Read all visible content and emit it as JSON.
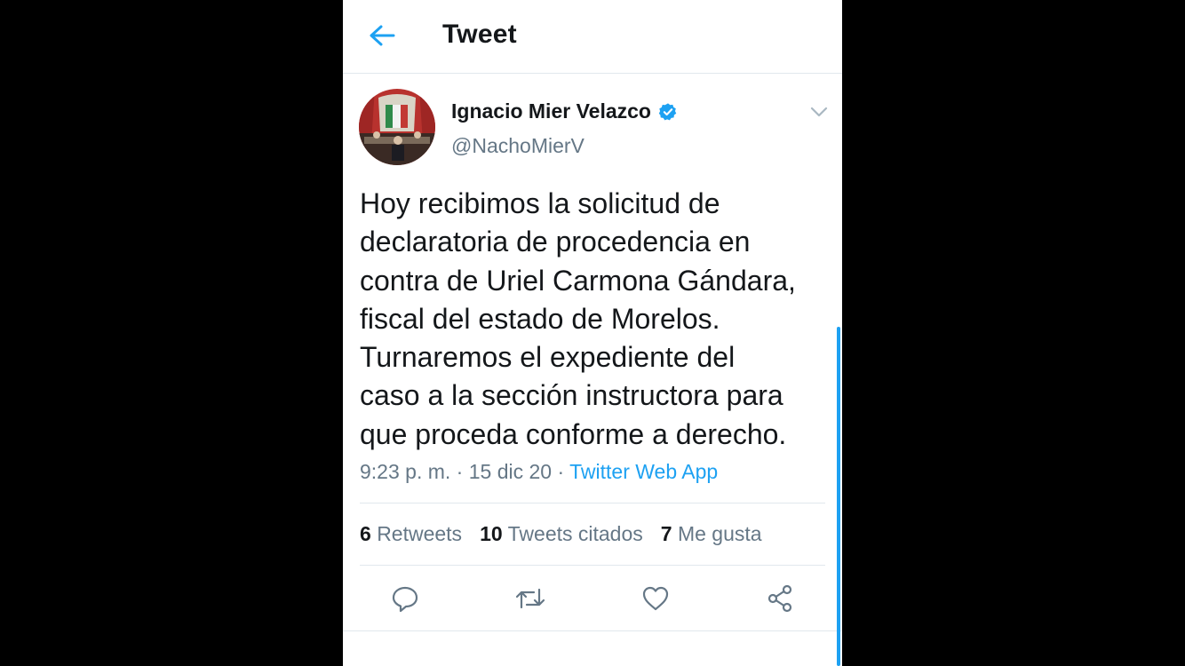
{
  "header": {
    "title": "Tweet",
    "back_icon": "arrow-left-icon"
  },
  "tweet": {
    "author": {
      "name": "Ignacio Mier Velazco",
      "handle": "@NachoMierV",
      "verified": true
    },
    "text": "Hoy recibimos la solicitud de\ndeclaratoria de procedencia en\ncontra de Uriel Carmona Gándara,\nfiscal del estado de Morelos.\nTurnaremos el expediente del\ncaso a la sección instructora para\nque proceda conforme a derecho.",
    "time": "9:23 p. m.",
    "date": "15 dic 20",
    "source": "Twitter Web App",
    "separator": " · "
  },
  "stats": [
    {
      "count": "6",
      "label": "Retweets"
    },
    {
      "count": "10",
      "label": "Tweets citados"
    },
    {
      "count": "7",
      "label": "Me gusta"
    }
  ],
  "actions": [
    "reply-icon",
    "retweet-icon",
    "like-icon",
    "share-icon"
  ],
  "colors": {
    "accent": "#1da1f2",
    "text": "#14171a",
    "secondary": "#657786",
    "divider": "#e1e8ed"
  }
}
